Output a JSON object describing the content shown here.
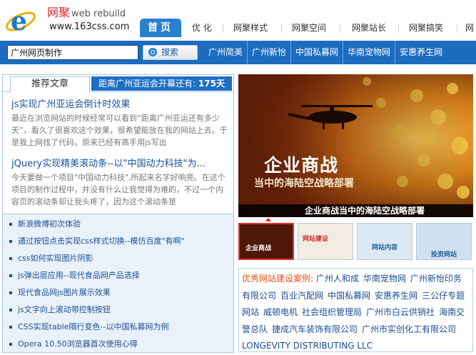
{
  "site": {
    "brand_cn": "网聚",
    "brand_en": "web rebuild",
    "url": "www.163css.com"
  },
  "nav": {
    "items": [
      "首页",
      "优 化",
      "网聚样式",
      "网聚空间",
      "网聚站长",
      "网聚搞笑",
      "网"
    ]
  },
  "search": {
    "value": "广州网页制作",
    "button_label": "搜索"
  },
  "quick_links": [
    "广州简美",
    "广州新怡",
    "中国私募网",
    "华南宠物网",
    "安惠养生网"
  ],
  "left": {
    "tab_label": "推荐文章",
    "countdown_prefix": "距离广州亚运会开幕还有:",
    "countdown_value": "175天",
    "articles": [
      {
        "title": "js实现广州亚运会倒计时效果",
        "excerpt": "最近在浏览网站的时候经常可以看到“距离广州亚运还有多少天”，看久了很喜欢这个效果，很希望能放在我的网站上去。于是我上网找了代码，原来已经有高手用js写出"
      },
      {
        "title": "jQuery实现精美滚动条--以\"中国动力科技\"为...",
        "excerpt": "今天要做一个项目\"中国动力科技\",所起来名字好响亮。在这个项目的制作过程中，并没有什么让我觉得为难的，不过一个内容页的滚动条却让我头疼了，因为这个滚动条是"
      }
    ],
    "list": [
      "新浪微博初次体验",
      "通过按钮点击实现css样式切换--模仿百度\"有啊\"",
      "css如何实现图片阴影",
      "js弹出层应用--现代食品网产品选择",
      "现代食品网js图片展示效果",
      "js文字向上滚动带控制按钮",
      "CSS实现table隔行变色--以中国私募网为例",
      "Opera 10.50浏览器首次使用心得"
    ]
  },
  "banner": {
    "title": "企业商战",
    "subtitle": "当中的海陆空战略部署",
    "caption": "企业商战当中的海陆空战略部署"
  },
  "thumbs": [
    {
      "label": "企业商战"
    },
    {
      "label": "网站建设"
    },
    {
      "label": "网站内容"
    },
    {
      "label": "投资网站"
    }
  ],
  "cases": {
    "label": "优秀网站建设案例:",
    "items": [
      "广州人和成",
      "华南宠物网",
      "广州新怡印务有限公司",
      "百业汽配网",
      "中国私募网",
      "安惠养生网",
      "三公仔专题网站",
      "威顿电机",
      "社会组织管理局",
      "广州市白云供销社",
      "海南交警总队",
      "捷成汽车装饰有限公司",
      "广州市实创化工有限公司",
      "LONGEVITY DISTRIBUTING LLC"
    ]
  },
  "colors": {
    "primary_blue": "#1d6cc0",
    "link_blue": "#1b4e92",
    "accent_red": "#d22"
  }
}
